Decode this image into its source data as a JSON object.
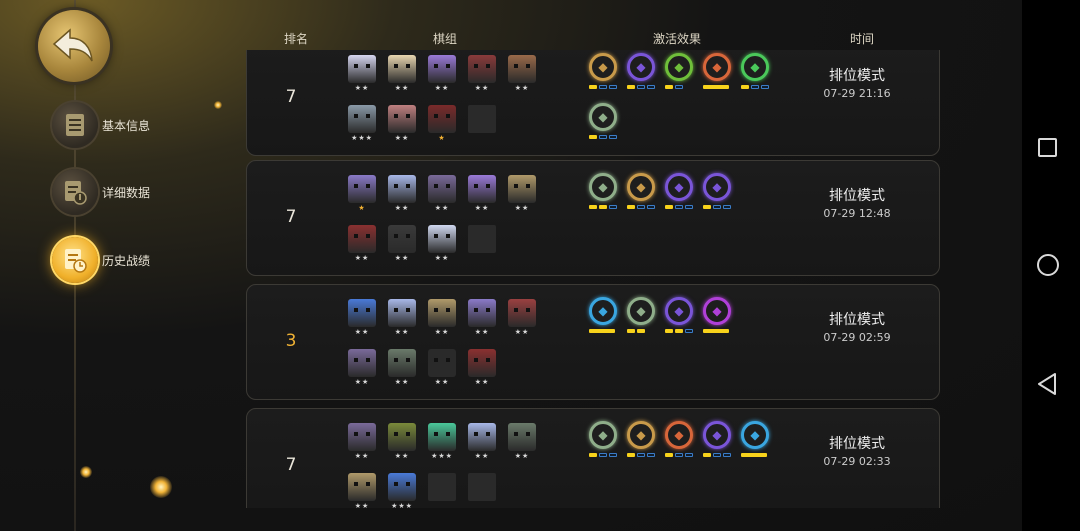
{
  "sidebar": {
    "items": [
      {
        "label": "基本信息",
        "icon": "document-icon",
        "active": false
      },
      {
        "label": "详细数据",
        "icon": "data-icon",
        "active": false
      },
      {
        "label": "历史战绩",
        "icon": "history-icon",
        "active": true
      }
    ]
  },
  "header": {
    "rank": "排名",
    "lineup": "棋组",
    "synergy": "激活效果",
    "time": "时间"
  },
  "colors": {
    "accent": "#f0b234",
    "syn_blue": "#3aa6e0",
    "syn_purple": "#7a55d8",
    "syn_green": "#6fbf3a",
    "syn_orange": "#d8663a",
    "syn_olive": "#8fae8a",
    "syn_magenta": "#b040d8",
    "syn_tan": "#c89a4a"
  },
  "records": [
    {
      "rank": "7",
      "mode": "排位模式",
      "time": "07-29 21:16",
      "units": [
        {
          "color": "#d6d6f0",
          "stars": "★★"
        },
        {
          "color": "#e8d6b0",
          "stars": "★★"
        },
        {
          "color": "#9a7ad8",
          "stars": "★★"
        },
        {
          "color": "#8a3a3a",
          "stars": "★★"
        },
        {
          "color": "#9a6a4a",
          "stars": "★★"
        },
        {
          "color": "#8a9aa8",
          "stars": "★★★"
        },
        {
          "color": "#c08080",
          "stars": "★★"
        },
        {
          "color": "#7a2a2a",
          "stars": "★",
          "gold": true
        },
        {
          "empty": true
        }
      ],
      "synergies": [
        {
          "icon": "axe-icon",
          "color": "#c89a4a",
          "bars": [
            1,
            0,
            0
          ]
        },
        {
          "icon": "fish-icon",
          "color": "#7a55d8",
          "bars": [
            1,
            0,
            0
          ]
        },
        {
          "icon": "leaf-icon",
          "color": "#6fbf3a",
          "bars": [
            1,
            0
          ]
        },
        {
          "icon": "demon-icon",
          "color": "#d8663a",
          "bars": [
            1
          ]
        },
        {
          "icon": "paw-icon",
          "color": "#4ac85a",
          "bars": [
            1,
            0,
            0
          ]
        },
        {
          "icon": "spirit-icon",
          "color": "#8fae8a",
          "bars": [
            1,
            0,
            0
          ]
        }
      ]
    },
    {
      "rank": "7",
      "mode": "排位模式",
      "time": "07-29 12:48",
      "units": [
        {
          "color": "#8a7ac8",
          "stars": "★",
          "gold": true
        },
        {
          "color": "#a8b8e8",
          "stars": "★★"
        },
        {
          "color": "#7a6a9a",
          "stars": "★★"
        },
        {
          "color": "#9a7ad8",
          "stars": "★★"
        },
        {
          "color": "#b09a6a",
          "stars": "★★"
        },
        {
          "color": "#8a3030",
          "stars": "★★"
        },
        {
          "color": "#3a3a3a",
          "stars": "★★"
        },
        {
          "color": "#d0d8f0",
          "stars": "★★"
        },
        {
          "empty": true
        }
      ],
      "synergies": [
        {
          "icon": "spirit-icon",
          "color": "#8fae8a",
          "bars": [
            1,
            1,
            0
          ]
        },
        {
          "icon": "axe-icon",
          "color": "#c89a4a",
          "bars": [
            1,
            0,
            0
          ]
        },
        {
          "icon": "fish-icon",
          "color": "#7a55d8",
          "bars": [
            1,
            0,
            0
          ]
        },
        {
          "icon": "mech-icon",
          "color": "#7a55d8",
          "bars": [
            1,
            0,
            0
          ]
        }
      ]
    },
    {
      "rank": "3",
      "mode": "排位模式",
      "time": "07-29 02:59",
      "units": [
        {
          "color": "#4a7ad8",
          "stars": "★★"
        },
        {
          "color": "#a8b8e8",
          "stars": "★★"
        },
        {
          "color": "#b09a6a",
          "stars": "★★"
        },
        {
          "color": "#8a7ac8",
          "stars": "★★"
        },
        {
          "color": "#9a4040",
          "stars": "★★"
        },
        {
          "color": "#7a6a9a",
          "stars": "★★"
        },
        {
          "color": "#6a7a6a",
          "stars": "★★"
        },
        {
          "color": "#2a2a2a",
          "stars": "★★"
        },
        {
          "color": "#8a3030",
          "stars": "★★"
        }
      ],
      "synergies": [
        {
          "icon": "dragon-icon",
          "color": "#3aa6e0",
          "bars": [
            1
          ]
        },
        {
          "icon": "spirit-icon",
          "color": "#8fae8a",
          "bars": [
            1,
            1
          ]
        },
        {
          "icon": "mech-icon",
          "color": "#7a55d8",
          "bars": [
            1,
            1,
            0
          ]
        },
        {
          "icon": "skull-icon",
          "color": "#b040d8",
          "bars": [
            1
          ]
        }
      ]
    },
    {
      "rank": "7",
      "mode": "排位模式",
      "time": "07-29 02:33",
      "units": [
        {
          "color": "#7a6a9a",
          "stars": "★★"
        },
        {
          "color": "#7a8a3a",
          "stars": "★★"
        },
        {
          "color": "#4ac89a",
          "stars": "★★★"
        },
        {
          "color": "#a8b8e8",
          "stars": "★★"
        },
        {
          "color": "#6a7a6a",
          "stars": "★★"
        },
        {
          "color": "#b09a6a",
          "stars": "★★"
        },
        {
          "color": "#4a7ad8",
          "stars": "★★★"
        },
        {
          "empty": true
        },
        {
          "empty": true
        }
      ],
      "synergies": [
        {
          "icon": "spirit-icon",
          "color": "#8fae8a",
          "bars": [
            1,
            0,
            0
          ]
        },
        {
          "icon": "gear-icon",
          "color": "#c89a4a",
          "bars": [
            1,
            0,
            0
          ]
        },
        {
          "icon": "goblin-icon",
          "color": "#d8663a",
          "bars": [
            1,
            0,
            0
          ]
        },
        {
          "icon": "mech-icon",
          "color": "#7a55d8",
          "bars": [
            1,
            0,
            0
          ]
        },
        {
          "icon": "dragon-icon",
          "color": "#3aa6e0",
          "bars": [
            1
          ]
        }
      ]
    }
  ]
}
